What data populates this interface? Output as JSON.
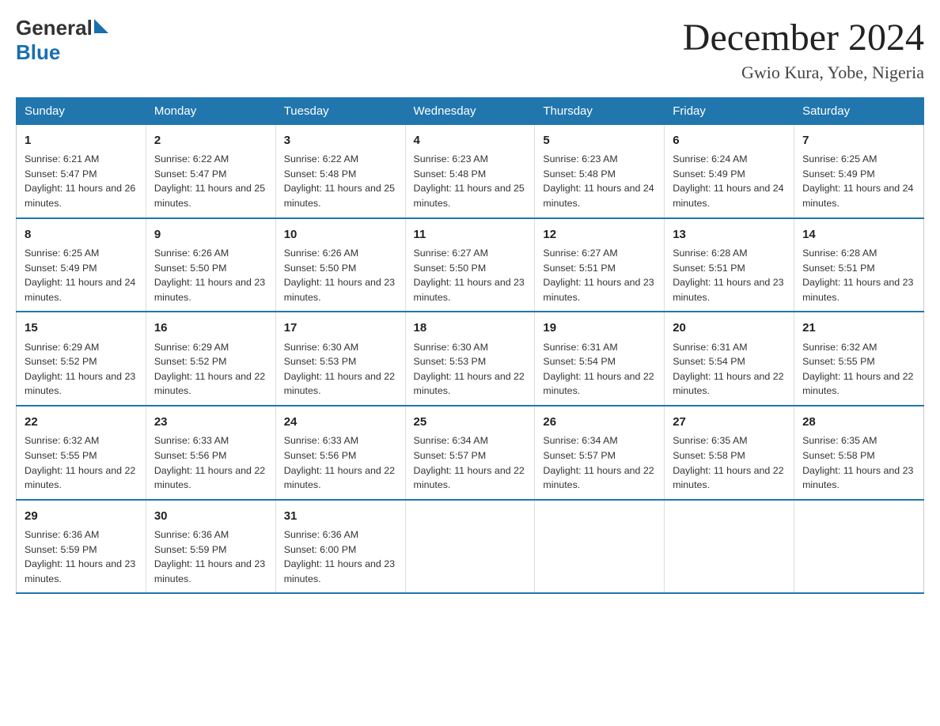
{
  "header": {
    "logo_general": "General",
    "logo_blue": "Blue",
    "month_title": "December 2024",
    "location": "Gwio Kura, Yobe, Nigeria"
  },
  "days_of_week": [
    "Sunday",
    "Monday",
    "Tuesday",
    "Wednesday",
    "Thursday",
    "Friday",
    "Saturday"
  ],
  "weeks": [
    [
      {
        "day": "1",
        "sunrise": "6:21 AM",
        "sunset": "5:47 PM",
        "daylight": "11 hours and 26 minutes."
      },
      {
        "day": "2",
        "sunrise": "6:22 AM",
        "sunset": "5:47 PM",
        "daylight": "11 hours and 25 minutes."
      },
      {
        "day": "3",
        "sunrise": "6:22 AM",
        "sunset": "5:48 PM",
        "daylight": "11 hours and 25 minutes."
      },
      {
        "day": "4",
        "sunrise": "6:23 AM",
        "sunset": "5:48 PM",
        "daylight": "11 hours and 25 minutes."
      },
      {
        "day": "5",
        "sunrise": "6:23 AM",
        "sunset": "5:48 PM",
        "daylight": "11 hours and 24 minutes."
      },
      {
        "day": "6",
        "sunrise": "6:24 AM",
        "sunset": "5:49 PM",
        "daylight": "11 hours and 24 minutes."
      },
      {
        "day": "7",
        "sunrise": "6:25 AM",
        "sunset": "5:49 PM",
        "daylight": "11 hours and 24 minutes."
      }
    ],
    [
      {
        "day": "8",
        "sunrise": "6:25 AM",
        "sunset": "5:49 PM",
        "daylight": "11 hours and 24 minutes."
      },
      {
        "day": "9",
        "sunrise": "6:26 AM",
        "sunset": "5:50 PM",
        "daylight": "11 hours and 23 minutes."
      },
      {
        "day": "10",
        "sunrise": "6:26 AM",
        "sunset": "5:50 PM",
        "daylight": "11 hours and 23 minutes."
      },
      {
        "day": "11",
        "sunrise": "6:27 AM",
        "sunset": "5:50 PM",
        "daylight": "11 hours and 23 minutes."
      },
      {
        "day": "12",
        "sunrise": "6:27 AM",
        "sunset": "5:51 PM",
        "daylight": "11 hours and 23 minutes."
      },
      {
        "day": "13",
        "sunrise": "6:28 AM",
        "sunset": "5:51 PM",
        "daylight": "11 hours and 23 minutes."
      },
      {
        "day": "14",
        "sunrise": "6:28 AM",
        "sunset": "5:51 PM",
        "daylight": "11 hours and 23 minutes."
      }
    ],
    [
      {
        "day": "15",
        "sunrise": "6:29 AM",
        "sunset": "5:52 PM",
        "daylight": "11 hours and 23 minutes."
      },
      {
        "day": "16",
        "sunrise": "6:29 AM",
        "sunset": "5:52 PM",
        "daylight": "11 hours and 22 minutes."
      },
      {
        "day": "17",
        "sunrise": "6:30 AM",
        "sunset": "5:53 PM",
        "daylight": "11 hours and 22 minutes."
      },
      {
        "day": "18",
        "sunrise": "6:30 AM",
        "sunset": "5:53 PM",
        "daylight": "11 hours and 22 minutes."
      },
      {
        "day": "19",
        "sunrise": "6:31 AM",
        "sunset": "5:54 PM",
        "daylight": "11 hours and 22 minutes."
      },
      {
        "day": "20",
        "sunrise": "6:31 AM",
        "sunset": "5:54 PM",
        "daylight": "11 hours and 22 minutes."
      },
      {
        "day": "21",
        "sunrise": "6:32 AM",
        "sunset": "5:55 PM",
        "daylight": "11 hours and 22 minutes."
      }
    ],
    [
      {
        "day": "22",
        "sunrise": "6:32 AM",
        "sunset": "5:55 PM",
        "daylight": "11 hours and 22 minutes."
      },
      {
        "day": "23",
        "sunrise": "6:33 AM",
        "sunset": "5:56 PM",
        "daylight": "11 hours and 22 minutes."
      },
      {
        "day": "24",
        "sunrise": "6:33 AM",
        "sunset": "5:56 PM",
        "daylight": "11 hours and 22 minutes."
      },
      {
        "day": "25",
        "sunrise": "6:34 AM",
        "sunset": "5:57 PM",
        "daylight": "11 hours and 22 minutes."
      },
      {
        "day": "26",
        "sunrise": "6:34 AM",
        "sunset": "5:57 PM",
        "daylight": "11 hours and 22 minutes."
      },
      {
        "day": "27",
        "sunrise": "6:35 AM",
        "sunset": "5:58 PM",
        "daylight": "11 hours and 22 minutes."
      },
      {
        "day": "28",
        "sunrise": "6:35 AM",
        "sunset": "5:58 PM",
        "daylight": "11 hours and 23 minutes."
      }
    ],
    [
      {
        "day": "29",
        "sunrise": "6:36 AM",
        "sunset": "5:59 PM",
        "daylight": "11 hours and 23 minutes."
      },
      {
        "day": "30",
        "sunrise": "6:36 AM",
        "sunset": "5:59 PM",
        "daylight": "11 hours and 23 minutes."
      },
      {
        "day": "31",
        "sunrise": "6:36 AM",
        "sunset": "6:00 PM",
        "daylight": "11 hours and 23 minutes."
      },
      {
        "day": "",
        "sunrise": "",
        "sunset": "",
        "daylight": ""
      },
      {
        "day": "",
        "sunrise": "",
        "sunset": "",
        "daylight": ""
      },
      {
        "day": "",
        "sunrise": "",
        "sunset": "",
        "daylight": ""
      },
      {
        "day": "",
        "sunrise": "",
        "sunset": "",
        "daylight": ""
      }
    ]
  ]
}
